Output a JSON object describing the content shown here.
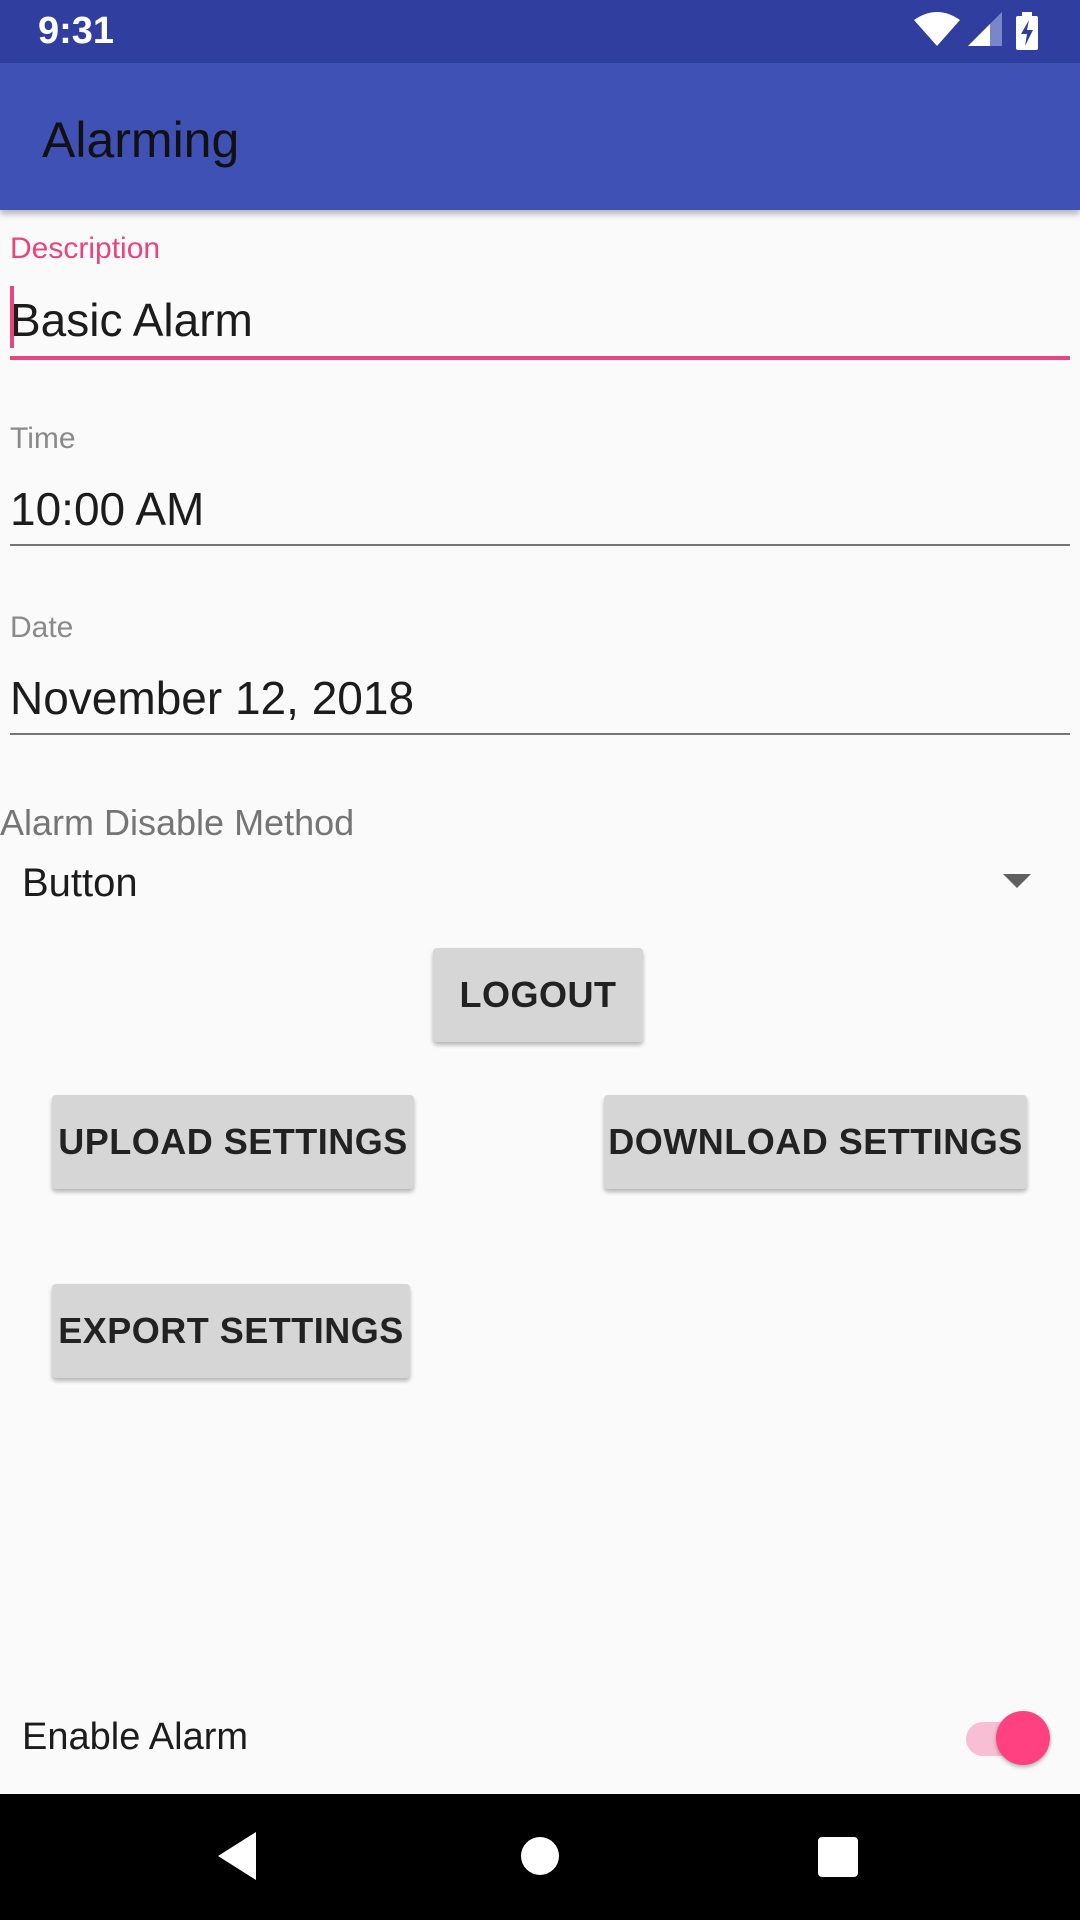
{
  "status_bar": {
    "time": "9:31",
    "icons": [
      "wifi-icon",
      "cellular-signal-icon",
      "battery-charging-icon"
    ]
  },
  "app_bar": {
    "title": "Alarming"
  },
  "form": {
    "description": {
      "label": "Description",
      "value": "Basic Alarm"
    },
    "time": {
      "label": "Time",
      "value": "10:00 AM"
    },
    "date": {
      "label": "Date",
      "value": "November 12, 2018"
    },
    "disable_method": {
      "label": "Alarm Disable Method",
      "selected": "Button"
    }
  },
  "buttons": {
    "logout": "LOGOUT",
    "upload": "UPLOAD SETTINGS",
    "download": "DOWNLOAD SETTINGS",
    "export": "EXPORT SETTINGS"
  },
  "enable_alarm": {
    "label": "Enable Alarm",
    "on": true
  },
  "colors": {
    "primary": "#3f51b5",
    "primary_dark": "#303f9f",
    "accent": "#ff4081",
    "focused_field": "#e8457e"
  }
}
